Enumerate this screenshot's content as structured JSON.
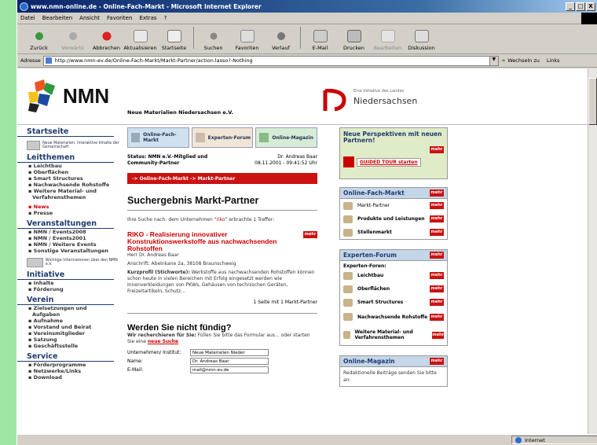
{
  "window": {
    "title": "www.nmn-online.de - Online-Fach-Markt - Microsoft Internet Explorer",
    "controls": [
      "_",
      "□",
      "X"
    ]
  },
  "menu": [
    "Datei",
    "Bearbeiten",
    "Ansicht",
    "Favoriten",
    "Extras",
    "?"
  ],
  "toolbar": [
    {
      "label": "Zurück",
      "icon": "back-arrow-icon",
      "enabled": true
    },
    {
      "label": "Vorwärts",
      "icon": "forward-arrow-icon",
      "enabled": false
    },
    {
      "label": "Abbrechen",
      "icon": "stop-icon",
      "enabled": true
    },
    {
      "label": "Aktualisieren",
      "icon": "refresh-icon",
      "enabled": true
    },
    {
      "label": "Startseite",
      "icon": "home-icon",
      "enabled": true
    },
    {
      "label": "Suchen",
      "icon": "search-icon",
      "enabled": true
    },
    {
      "label": "Favoriten",
      "icon": "favorites-icon",
      "enabled": true
    },
    {
      "label": "Verlauf",
      "icon": "history-icon",
      "enabled": true
    },
    {
      "label": "E-Mail",
      "icon": "mail-icon",
      "enabled": true
    },
    {
      "label": "Drucken",
      "icon": "print-icon",
      "enabled": true
    },
    {
      "label": "Bearbeiten",
      "icon": "edit-icon",
      "enabled": false
    },
    {
      "label": "Diskussion",
      "icon": "discussion-icon",
      "enabled": true
    }
  ],
  "address": {
    "label": "Adresse",
    "url": "http://www.nmn-ev.de/Online-Fach-Markt/Markt-Partner/action.lasso?-Nothing",
    "go_label": "Wechseln zu",
    "links_label": "Links"
  },
  "status": {
    "left": "",
    "zone": "Internet"
  },
  "header": {
    "logo_text": "NMN",
    "org": "Neue Materialien Niedersachsen e.V.",
    "nds_small": "Eine Initiative des Landes",
    "nds_big": "Niedersachsen"
  },
  "left_nav": {
    "startseite": "Startseite",
    "promo1": "Neue Materialien: Interaktive Inhalte der Gemeinschaft",
    "leitthemen": {
      "title": "Leitthemen",
      "items": [
        "Leichtbau",
        "Oberflächen",
        "Smart Structures",
        "Nachwachsende Rohstoffe",
        "Weitere Material- und",
        "Verfahrensthemen"
      ]
    },
    "news": [
      "News",
      "Presse"
    ],
    "veranstaltungen": {
      "title": "Veranstaltungen",
      "items": [
        "NMN / Events2008",
        "NMN / Events2001",
        "NMN / Weitere Events",
        "Sonstige Veranstaltungen"
      ]
    },
    "promo2": "Wichtige Informationen über den NMN e.V.",
    "initiative": {
      "title": "Initiative",
      "items": [
        "Inhalte",
        "Förderung"
      ]
    },
    "verein": {
      "title": "Verein",
      "items": [
        "Zielsetzungen und",
        "Aufgaben",
        "Aufnahme",
        "Vorstand und Beirat",
        "Vereinsmitglieder",
        "Satzung",
        "Geschäftsstelle"
      ]
    },
    "service": {
      "title": "Service",
      "items": [
        "Förderprogramme",
        "Netzwerke/Links",
        "Download"
      ]
    }
  },
  "main": {
    "tabs": [
      "Online-Fach-Markt",
      "Experten-Forum",
      "Online-Magazin"
    ],
    "status_left": "Status: NMN e.V.-Mitglied und Community-Partner",
    "status_user": "Dr. Andreas Baar",
    "status_date": "08.11.2001 - 09:41:52 Uhr",
    "breadcrumb": "-> Online-Fach-Markt -> Markt-Partner",
    "heading": "Suchergebnis Markt-Partner",
    "search_text_before": "Ihre Suche nach: dem Unternehmen \"",
    "search_term": "riko",
    "search_text_after": "\" erbrachte 1 Treffer:",
    "result_title": "RIKO - Realisierung innovativer Konstruktionswerkstoffe aus nachwachsenden Rohstoffen",
    "result_person": "Herr Dr. Andreas Baar",
    "result_address": "Anschrift: Abelnkane 2a, 38108 Braunschweig",
    "result_profile_label": "Kurzprofil (Stichworte):",
    "result_profile": "Werkstoffe aus nachwachsenden Rohstoffen können schon heute in vielen Bereichen mit Erfolg eingesetzt werden wie Innenverkleidungen von PKWs, Gehäusen von technischen Geräten, Freizeitartikeln, Schutz...",
    "more": "mehr",
    "pager": "1 Seite mit 1 Markt-Partner",
    "not_found_heading": "Werden Sie nicht fündig?",
    "not_found_text_bold": "Wir recherchieren für Sie:",
    "not_found_text": "Füllen Sie bitte das Formular aus... oder starten Sie eine",
    "not_found_link": "neue Suche",
    "form": [
      {
        "label": "Unternehmen/ Institut:",
        "value": "Neue Materialien Nieder"
      },
      {
        "label": "Name:",
        "value": "Dr. Andreas Baar"
      },
      {
        "label": "E-Mail:",
        "value": "mail@nmn-ev.de"
      }
    ]
  },
  "right": {
    "promo_title": "Neue Perspektiven mit neuen Partnern!",
    "promo_button": "GUIDED TOUR starten",
    "fach_markt": {
      "title": "Online-Fach-Markt",
      "items": [
        "Markt-Partner",
        "Produkte und Leistungen",
        "Stellenmarkt"
      ]
    },
    "experten": {
      "title": "Experten-Forum",
      "sub": "Experten-Foren:",
      "items": [
        "Leichtbau",
        "Oberflächen",
        "Smart Structures",
        "Nachwachsende Rohstoffe",
        "Weitere Material- und Verfahrensthemen"
      ]
    },
    "magazin": {
      "title": "Online-Magazin",
      "text": "Redaktionelle Beiträge senden Sie bitte an:"
    }
  },
  "colors": {
    "accent_red": "#cc1111",
    "nav_blue": "#1f3b6f",
    "desktop_green": "#9fe6a4",
    "title_blue": "#0a246a"
  }
}
